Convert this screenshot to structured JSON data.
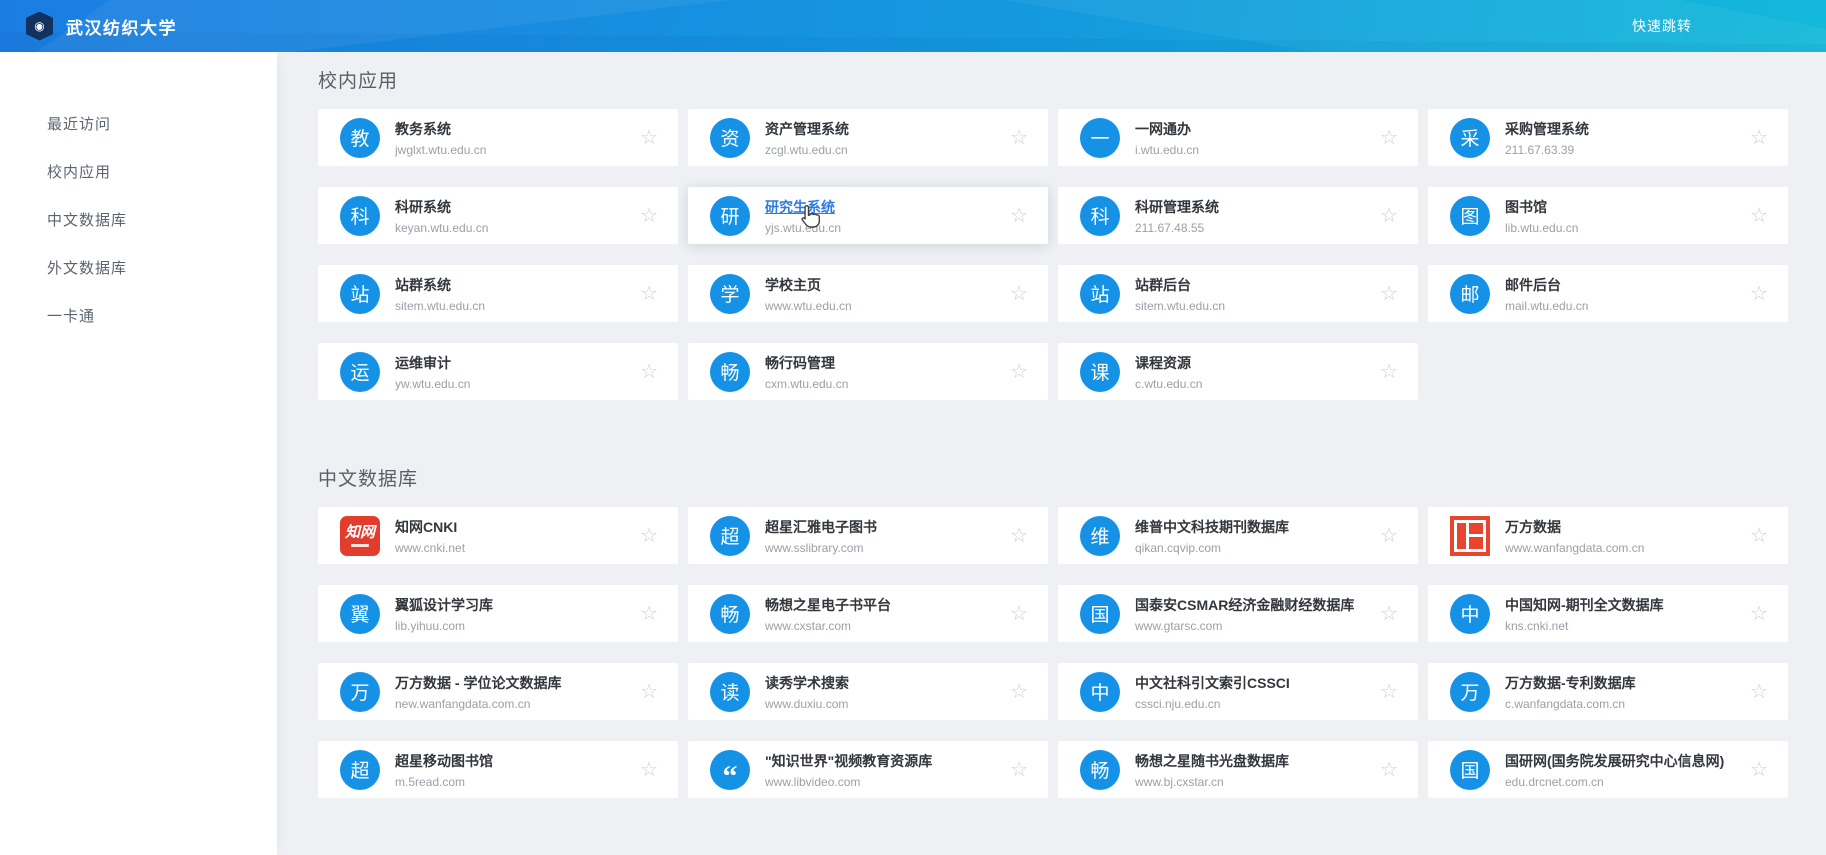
{
  "header": {
    "title": "武汉纺织大学",
    "quick_jump": "快速跳转"
  },
  "sidebar": {
    "items": [
      {
        "label": "最近访问"
      },
      {
        "label": "校内应用"
      },
      {
        "label": "中文数据库"
      },
      {
        "label": "外文数据库"
      },
      {
        "label": "一卡通"
      }
    ]
  },
  "sections": [
    {
      "title": "校内应用",
      "apps": [
        {
          "name": "教务系统",
          "url": "jwglxt.wtu.edu.cn",
          "icon": "教",
          "icon_type": "blue-circle"
        },
        {
          "name": "资产管理系统",
          "url": "zcgl.wtu.edu.cn",
          "icon": "资",
          "icon_type": "blue-circle"
        },
        {
          "name": "一网通办",
          "url": "i.wtu.edu.cn",
          "icon": "一",
          "icon_type": "blue-circle"
        },
        {
          "name": "采购管理系统",
          "url": "211.67.63.39",
          "icon": "采",
          "icon_type": "blue-circle"
        },
        {
          "name": "科研系统",
          "url": "keyan.wtu.edu.cn",
          "icon": "科",
          "icon_type": "blue-circle"
        },
        {
          "name": "研究生系统",
          "url": "yjs.wtu.edu.cn",
          "icon": "研",
          "icon_type": "blue-circle",
          "hover": true
        },
        {
          "name": "科研管理系统",
          "url": "211.67.48.55",
          "icon": "科",
          "icon_type": "blue-circle"
        },
        {
          "name": "图书馆",
          "url": "lib.wtu.edu.cn",
          "icon": "图",
          "icon_type": "blue-circle"
        },
        {
          "name": "站群系统",
          "url": "sitem.wtu.edu.cn",
          "icon": "站",
          "icon_type": "blue-circle"
        },
        {
          "name": "学校主页",
          "url": "www.wtu.edu.cn",
          "icon": "学",
          "icon_type": "blue-circle"
        },
        {
          "name": "站群后台",
          "url": "sitem.wtu.edu.cn",
          "icon": "站",
          "icon_type": "blue-circle"
        },
        {
          "name": "邮件后台",
          "url": "mail.wtu.edu.cn",
          "icon": "邮",
          "icon_type": "blue-circle"
        },
        {
          "name": "运维审计",
          "url": "yw.wtu.edu.cn",
          "icon": "运",
          "icon_type": "blue-circle"
        },
        {
          "name": "畅行码管理",
          "url": "cxm.wtu.edu.cn",
          "icon": "畅",
          "icon_type": "blue-circle"
        },
        {
          "name": "课程资源",
          "url": "c.wtu.edu.cn",
          "icon": "课",
          "icon_type": "blue-circle"
        }
      ]
    },
    {
      "title": "中文数据库",
      "apps": [
        {
          "name": "知网CNKI",
          "url": "www.cnki.net",
          "icon": "知网",
          "icon_type": "cnki"
        },
        {
          "name": "超星汇雅电子图书",
          "url": "www.sslibrary.com",
          "icon": "超",
          "icon_type": "blue-circle"
        },
        {
          "name": "维普中文科技期刊数据库",
          "url": "qikan.cqvip.com",
          "icon": "维",
          "icon_type": "blue-circle"
        },
        {
          "name": "万方数据",
          "url": "www.wanfangdata.com.cn",
          "icon": "",
          "icon_type": "wanfang"
        },
        {
          "name": "翼狐设计学习库",
          "url": "lib.yihuu.com",
          "icon": "翼",
          "icon_type": "blue-circle"
        },
        {
          "name": "畅想之星电子书平台",
          "url": "www.cxstar.com",
          "icon": "畅",
          "icon_type": "blue-circle"
        },
        {
          "name": "国泰安CSMAR经济金融财经数据库",
          "url": "www.gtarsc.com",
          "icon": "国",
          "icon_type": "blue-circle"
        },
        {
          "name": "中国知网-期刊全文数据库",
          "url": "kns.cnki.net",
          "icon": "中",
          "icon_type": "blue-circle"
        },
        {
          "name": "万方数据 - 学位论文数据库",
          "url": "new.wanfangdata.com.cn",
          "icon": "万",
          "icon_type": "blue-circle"
        },
        {
          "name": "读秀学术搜索",
          "url": "www.duxiu.com",
          "icon": "读",
          "icon_type": "blue-circle"
        },
        {
          "name": "中文社科引文索引CSSCI",
          "url": "cssci.nju.edu.cn",
          "icon": "中",
          "icon_type": "blue-circle"
        },
        {
          "name": "万方数据-专利数据库",
          "url": "c.wanfangdata.com.cn",
          "icon": "万",
          "icon_type": "blue-circle"
        },
        {
          "name": "超星移动图书馆",
          "url": "m.5read.com",
          "icon": "超",
          "icon_type": "blue-circle"
        },
        {
          "name": "\"知识世界\"视频教育资源库",
          "url": "www.libvideo.com",
          "icon": "“",
          "icon_type": "quote"
        },
        {
          "name": "畅想之星随书光盘数据库",
          "url": "www.bj.cxstar.cn",
          "icon": "畅",
          "icon_type": "blue-circle"
        },
        {
          "name": "国研网(国务院发展研究中心信息网)",
          "url": "edu.drcnet.com.cn",
          "icon": "国",
          "icon_type": "blue-circle"
        }
      ]
    }
  ],
  "colors": {
    "header_gradient_start": "#1b7de2",
    "header_gradient_end": "#13b9da",
    "icon_blue": "#1592e6",
    "cnki_red": "#e23c2d",
    "wanfang_red": "#e8442e",
    "hover_link_blue": "#2b7be4"
  }
}
